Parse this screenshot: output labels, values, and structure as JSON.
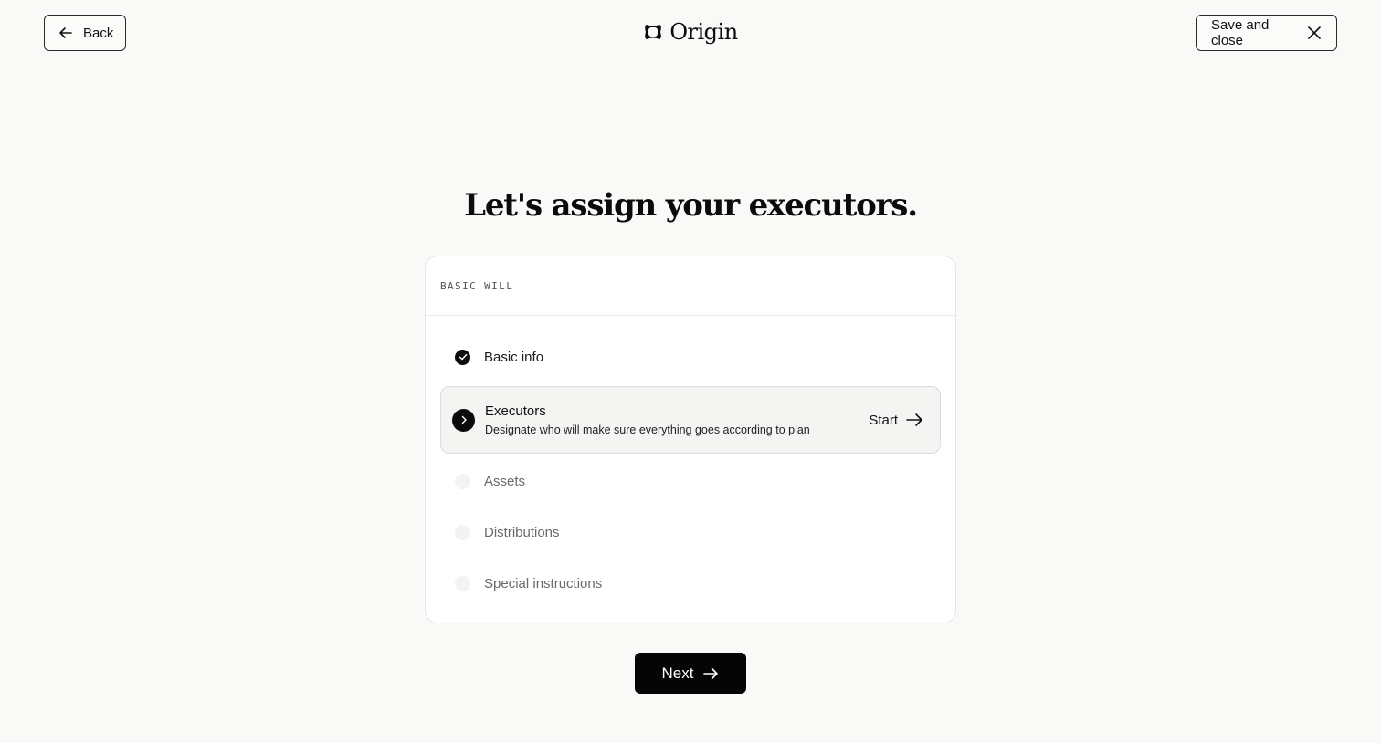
{
  "header": {
    "back_label": "Back",
    "brand": "Origin",
    "save_label": "Save and close"
  },
  "main": {
    "title": "Let's assign your executors."
  },
  "card": {
    "label": "BASIC WILL",
    "steps": [
      {
        "label": "Basic info",
        "status": "done"
      },
      {
        "label": "Executors",
        "description": "Designate who will make sure everything goes according to plan",
        "status": "active",
        "action_label": "Start"
      },
      {
        "label": "Assets",
        "status": "pending"
      },
      {
        "label": "Distributions",
        "status": "pending"
      },
      {
        "label": "Special instructions",
        "status": "pending"
      }
    ]
  },
  "footer": {
    "next_label": "Next"
  },
  "colors": {
    "background": "#f9f9f7",
    "primary": "#050505",
    "card": "#ffffff",
    "active_row": "#f4f4f3"
  },
  "icons": {
    "back": "arrow-left-icon",
    "close": "close-icon",
    "logo": "origin-logo-icon",
    "done": "check-circle-icon",
    "active": "chevron-right-icon",
    "forward": "arrow-right-icon"
  }
}
